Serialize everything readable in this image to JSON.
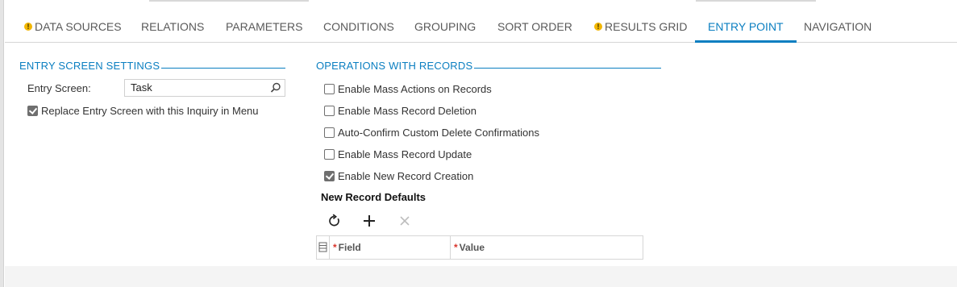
{
  "tabs": [
    {
      "label": "DATA SOURCES",
      "warning": true,
      "active": false
    },
    {
      "label": "RELATIONS",
      "warning": false,
      "active": false
    },
    {
      "label": "PARAMETERS",
      "warning": false,
      "active": false
    },
    {
      "label": "CONDITIONS",
      "warning": false,
      "active": false
    },
    {
      "label": "GROUPING",
      "warning": false,
      "active": false
    },
    {
      "label": "SORT ORDER",
      "warning": false,
      "active": false
    },
    {
      "label": "RESULTS GRID",
      "warning": true,
      "active": false
    },
    {
      "label": "ENTRY POINT",
      "warning": false,
      "active": true
    },
    {
      "label": "NAVIGATION",
      "warning": false,
      "active": false
    }
  ],
  "warning_glyph": "!",
  "entry_settings": {
    "title": "ENTRY SCREEN SETTINGS",
    "entry_screen_label": "Entry Screen:",
    "entry_screen_value": "Task",
    "replace_label": "Replace Entry Screen with this Inquiry in Menu",
    "replace_checked": true
  },
  "operations": {
    "title": "OPERATIONS WITH RECORDS",
    "options": [
      {
        "label": "Enable Mass Actions on Records",
        "checked": false
      },
      {
        "label": "Enable Mass Record Deletion",
        "checked": false
      },
      {
        "label": "Auto-Confirm Custom Delete Confirmations",
        "checked": false
      },
      {
        "label": "Enable Mass Record Update",
        "checked": false
      },
      {
        "label": "Enable New Record Creation",
        "checked": true
      }
    ]
  },
  "defaults": {
    "title": "New Record Defaults",
    "columns": [
      {
        "label": "Field",
        "required": true
      },
      {
        "label": "Value",
        "required": true
      }
    ],
    "required_mark": "*"
  },
  "colors": {
    "accent": "#0b7fc1",
    "warning": "#f2b600",
    "required": "#d9342b"
  },
  "icons": {
    "refresh": "refresh-icon",
    "add": "add-icon",
    "delete": "close-icon",
    "search": "search-icon",
    "column_config": "column-config-icon"
  }
}
